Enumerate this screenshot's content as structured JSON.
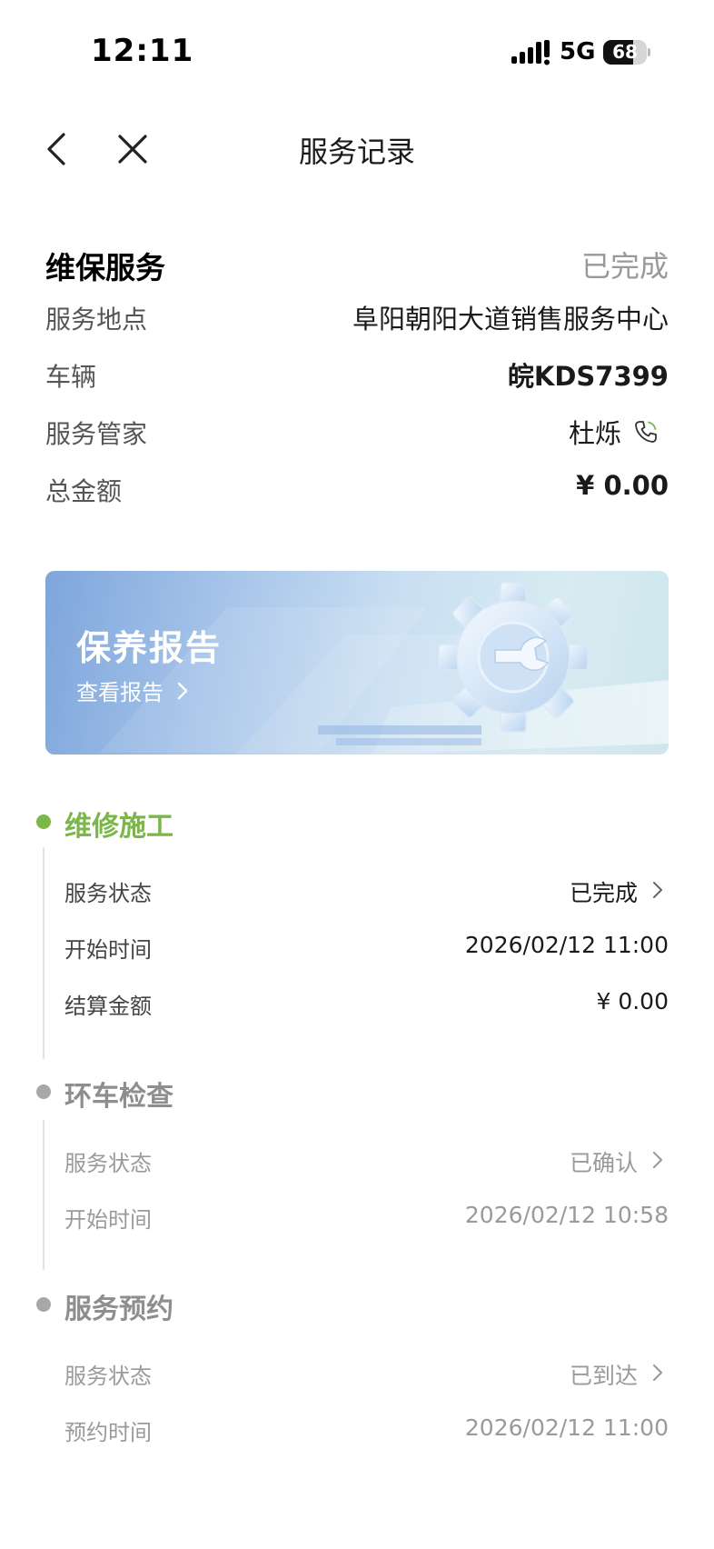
{
  "status_bar": {
    "time": "12:11",
    "network": "5G",
    "battery": 68
  },
  "nav": {
    "title": "服务记录"
  },
  "summary": {
    "title": "维保服务",
    "status": "已完成",
    "rows": [
      {
        "label": "服务地点",
        "value": "阜阳朝阳大道销售服务中心"
      },
      {
        "label": "车辆",
        "value": "皖KDS7399"
      },
      {
        "label": "服务管家",
        "value": "杜烁"
      },
      {
        "label": "总金额",
        "value": "¥ 0.00"
      }
    ]
  },
  "report": {
    "title": "保养报告",
    "link": "查看报告"
  },
  "timeline": [
    {
      "title": "维修施工",
      "rows": [
        {
          "label": "服务状态",
          "value": "已完成"
        },
        {
          "label": "开始时间",
          "value": "2026/02/12 11:00"
        },
        {
          "label": "结算金额",
          "value": "¥  0.00"
        }
      ]
    },
    {
      "title": "环车检查",
      "rows": [
        {
          "label": "服务状态",
          "value": "已确认"
        },
        {
          "label": "开始时间",
          "value": "2026/02/12 10:58"
        }
      ]
    },
    {
      "title": "服务预约",
      "rows": [
        {
          "label": "服务状态",
          "value": "已到达"
        },
        {
          "label": "预约时间",
          "value": "2026/02/12 11:00"
        }
      ]
    }
  ],
  "colors": {
    "accent_green": "#7ab648",
    "inactive_gray": "#a8a8a8",
    "banner_blue": "#7ea6dc"
  },
  "icons": {
    "nav_back": "chevron-left-icon",
    "nav_close": "close-icon",
    "phone": "phone-icon",
    "row_arrow": "chevron-right-icon",
    "banner_art": "gear-wrench-icon"
  }
}
